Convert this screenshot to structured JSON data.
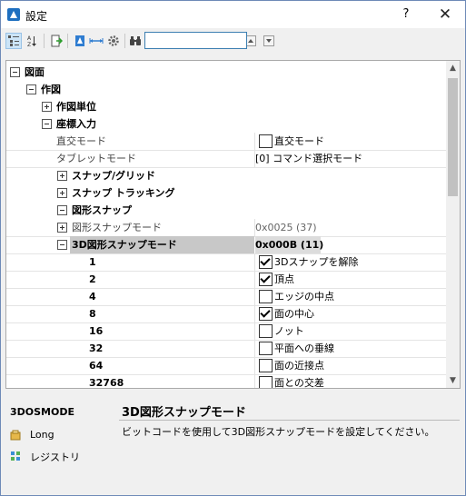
{
  "window": {
    "title": "設定",
    "help": "?",
    "close": "✕"
  },
  "toolbar": {
    "search_value": "",
    "up": "▲",
    "down": "▼"
  },
  "tree": {
    "root": {
      "label": "図面",
      "expanded": true
    },
    "drawing": {
      "label": "作図",
      "expanded": true
    },
    "units": {
      "label": "作図単位",
      "expanded": false
    },
    "coord": {
      "label": "座標入力",
      "expanded": true
    },
    "ortho": {
      "name": "直交モード",
      "value": "直交モード",
      "checked": false
    },
    "tablet": {
      "name": "タブレットモード",
      "value": "[0] コマンド選択モード"
    },
    "snap_grid": {
      "label": "スナップ/グリッド",
      "expanded": false
    },
    "snap_tracking": {
      "label": "スナップ トラッキング",
      "expanded": false
    },
    "osnap": {
      "label": "図形スナップ",
      "expanded": true
    },
    "osmode": {
      "name": "図形スナップモード",
      "value": "0x0025 (37)"
    },
    "osmode3d": {
      "name": "3D図形スナップモード",
      "value": "0x000B (11)"
    },
    "bits": [
      {
        "code": "1",
        "label": "3Dスナップを解除",
        "checked": true
      },
      {
        "code": "2",
        "label": "頂点",
        "checked": true
      },
      {
        "code": "4",
        "label": "エッジの中点",
        "checked": false
      },
      {
        "code": "8",
        "label": "面の中心",
        "checked": true
      },
      {
        "code": "16",
        "label": "ノット",
        "checked": false
      },
      {
        "code": "32",
        "label": "平面への垂線",
        "checked": false
      },
      {
        "code": "64",
        "label": "面の近接点",
        "checked": false
      },
      {
        "code": "32768",
        "label": "面との交差",
        "checked": false
      }
    ]
  },
  "footer": {
    "variable": "3DOSMODE",
    "type": "Long",
    "location": "レジストリ",
    "title": "3D図形スナップモード",
    "description": "ビットコードを使用して3D図形スナップモードを設定してください。"
  },
  "colors": {
    "accent": "#0078d7",
    "selection": "#c8c8c8",
    "border": "#a9a9a9"
  }
}
